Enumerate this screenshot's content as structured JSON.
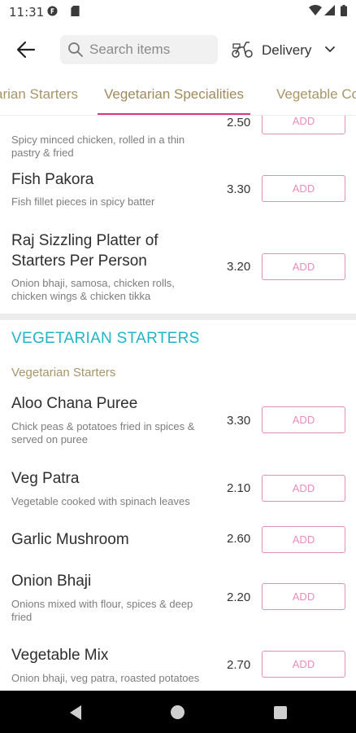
{
  "status_bar": {
    "time": "11:31",
    "left_icons": [
      "app-badge-icon",
      "sd-card-icon"
    ],
    "right_icons": [
      "wifi-icon",
      "signal-icon",
      "battery-icon"
    ]
  },
  "header": {
    "back_icon": "arrow-left-icon",
    "search": {
      "placeholder": "Search items",
      "value": ""
    },
    "delivery": {
      "icon": "scooter-icon",
      "label": "Delivery",
      "chevron": "chevron-down-icon"
    }
  },
  "tabs": [
    {
      "label": "arian Starters",
      "active": false
    },
    {
      "label": "Vegetarian Specialities",
      "active": true
    },
    {
      "label": "Vegetable Co",
      "active": false
    }
  ],
  "colors": {
    "accent_pink": "#d63a83",
    "add_border": "#e58dbd",
    "section_teal": "#1fb5c9",
    "subheading_gold": "#a89568"
  },
  "add_label": "ADD",
  "partial_item": {
    "desc": "Spicy minced chicken, rolled in a thin pastry & fried",
    "price": "2.50"
  },
  "items_top": [
    {
      "name": "Fish Pakora",
      "desc": "Fish fillet pieces in spicy batter",
      "price": "3.30"
    },
    {
      "name": "Raj Sizzling Platter of Starters Per Person",
      "desc": "Onion bhaji, samosa, chicken rolls, chicken wings & chicken tikka",
      "price": "3.20"
    }
  ],
  "section": {
    "title": "VEGETARIAN STARTERS",
    "subtitle": "Vegetarian Starters"
  },
  "items_veg": [
    {
      "name": "Aloo Chana Puree",
      "desc": "Chick peas & potatoes fried in spices & served on puree",
      "price": "3.30"
    },
    {
      "name": "Veg Patra",
      "desc": "Vegetable cooked with spinach leaves",
      "price": "2.10"
    },
    {
      "name": "Garlic Mushroom",
      "desc": "",
      "price": "2.60"
    },
    {
      "name": "Onion Bhaji",
      "desc": "Onions mixed with flour, spices & deep fried",
      "price": "2.20"
    },
    {
      "name": "Vegetable Mix",
      "desc": "Onion bhaji, veg patra, roasted potatoes",
      "price": "2.70"
    }
  ],
  "nav_bar": {
    "icons": [
      "nav-back-icon",
      "nav-home-icon",
      "nav-recents-icon"
    ]
  }
}
